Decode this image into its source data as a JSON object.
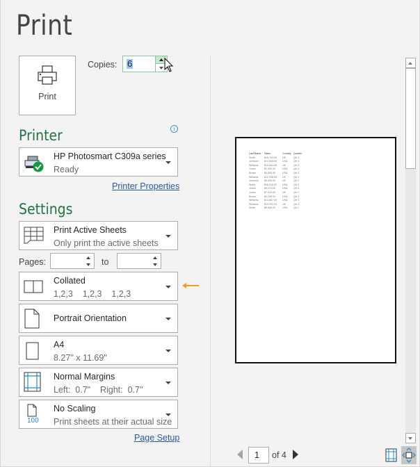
{
  "title": "Print",
  "print_button": {
    "label": "Print",
    "icon": "printer-icon"
  },
  "copies": {
    "label": "Copies:",
    "value": "6"
  },
  "printer": {
    "section_title": "Printer",
    "info_icon": "info-icon",
    "name": "HP Photosmart C309a series",
    "status": "Ready",
    "properties_link": "Printer Properties"
  },
  "settings": {
    "section_title": "Settings",
    "what_to_print": {
      "title": "Print Active Sheets",
      "subtitle": "Only print the active sheets"
    },
    "pages": {
      "label": "Pages:",
      "from_value": "",
      "to_label": "to",
      "to_value": ""
    },
    "collation": {
      "title": "Collated",
      "subtitle": "1,2,3    1,2,3    1,2,3"
    },
    "orientation": {
      "title": "Portrait Orientation"
    },
    "paper_size": {
      "title": "A4",
      "subtitle": "8.27\" x 11.69\""
    },
    "margins": {
      "title": "Normal Margins",
      "subtitle": "Left:  0.7\"    Right:  0.7\""
    },
    "scaling": {
      "title": "No Scaling",
      "subtitle": "Print sheets at their actual size",
      "icon_label": "100"
    },
    "page_setup_link": "Page Setup"
  },
  "annotation_arrow_color": "#f59b1c",
  "accent_color": "#217346",
  "preview": {
    "headers": [
      "Last Name",
      "Sales",
      "Country",
      "Quarter"
    ],
    "rows": [
      [
        "Smith",
        "$16,753.00",
        "UK",
        "Qtr 3"
      ],
      [
        "Johnson",
        "$14,808.00",
        "USA",
        "Qtr 4"
      ],
      [
        "Williams",
        "$10,644.00",
        "UK",
        "Qtr 2"
      ],
      [
        "Jones",
        "$1,390.00",
        "USA",
        "Qtr 3"
      ],
      [
        "Brown",
        "$4,865.00",
        "USA",
        "Qtr 4"
      ],
      [
        "Williams",
        "$12,438.00",
        "UK",
        "Qtr 1"
      ],
      [
        "Johnson",
        "$9,339.00",
        "UK",
        "Qtr 2"
      ],
      [
        "Smith",
        "$18,919.00",
        "USA",
        "Qtr 3"
      ],
      [
        "Jones",
        "$9,213.00",
        "USA",
        "Qtr 4"
      ],
      [
        "Jones",
        "$7,433.00",
        "UK",
        "Qtr 1"
      ],
      [
        "Brown",
        "$3,255.00",
        "USA",
        "Qtr 2"
      ],
      [
        "Williams",
        "$14,867.00",
        "USA",
        "Qtr 3"
      ],
      [
        "Williams",
        "$19,302.00",
        "UK",
        "Qtr 4"
      ],
      [
        "Smith",
        "$9,698.00",
        "USA",
        "Qtr 1"
      ]
    ]
  },
  "navigation": {
    "current_page": "1",
    "of_label": "of 4"
  }
}
